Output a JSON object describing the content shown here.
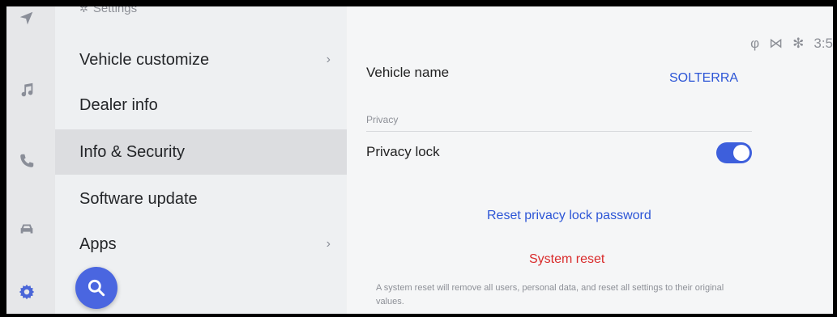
{
  "header": {
    "title": "Settings"
  },
  "rail": {
    "icons": [
      "navigation-arrow-icon",
      "music-note-icon",
      "phone-icon",
      "car-icon",
      "gear-icon"
    ]
  },
  "menu": {
    "items": [
      {
        "label": "Vehicle customize",
        "chevron": "›"
      },
      {
        "label": "Dealer info",
        "chevron": ""
      },
      {
        "label": "Info & Security",
        "chevron": ""
      },
      {
        "label": "Software update",
        "chevron": ""
      },
      {
        "label": "Apps",
        "chevron": "›"
      }
    ],
    "selected_index": 2
  },
  "status": {
    "time": "3:5"
  },
  "detail": {
    "vehicle_name_label": "Vehicle name",
    "vehicle_name_value": "SOLTERRA",
    "privacy_section": "Privacy",
    "privacy_lock_label": "Privacy lock",
    "privacy_lock_on": true,
    "reset_password_link": "Reset privacy lock password",
    "system_reset_link": "System reset",
    "system_reset_note": "A system reset will remove all users, personal data, and reset all settings to their original values."
  },
  "colors": {
    "accent": "#3d5fdc",
    "danger": "#d92b2b",
    "link": "#2c55d6"
  }
}
